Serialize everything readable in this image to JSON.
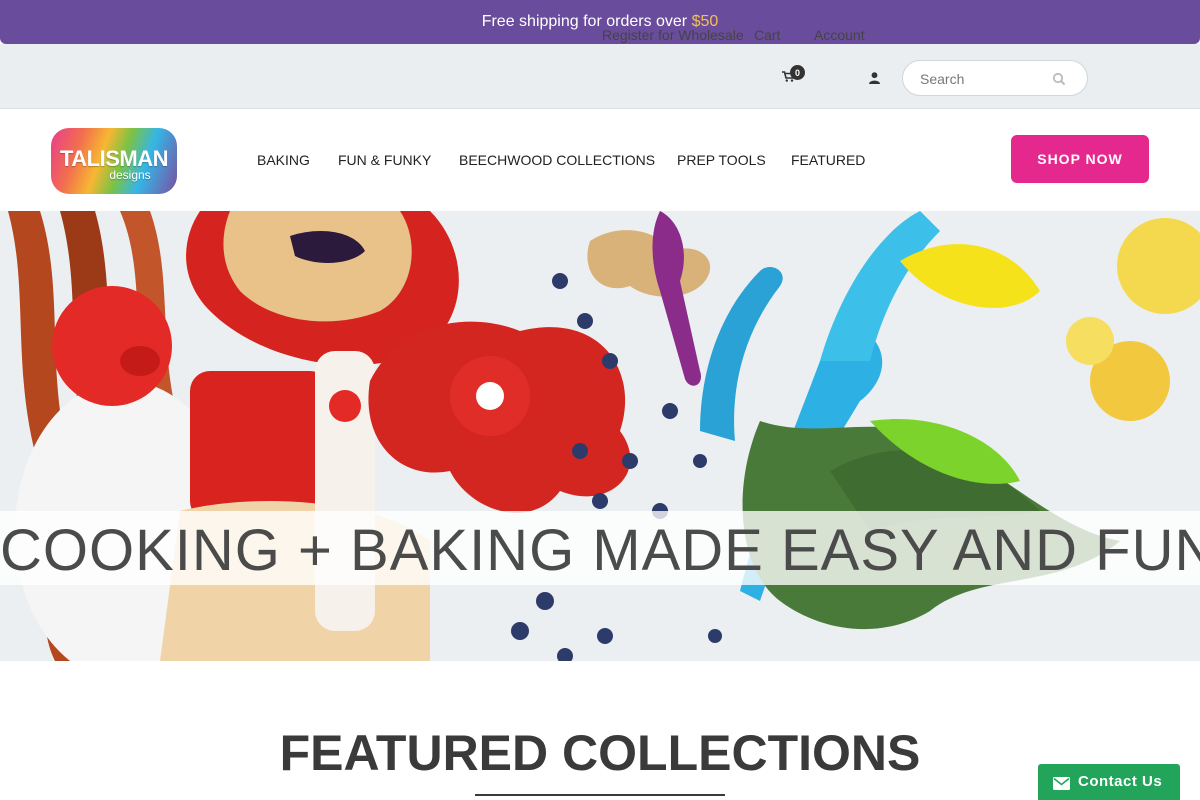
{
  "promo": {
    "text": "Free shipping for orders over",
    "amount": "$50"
  },
  "utility": {
    "wholesale_label": "Register for Wholesale",
    "cart_label": "Cart",
    "cart_count": "0",
    "account_label": "Account",
    "search_placeholder": "Search"
  },
  "nav": {
    "logo_main": "TALISMAN",
    "logo_sub": "designs",
    "items": [
      {
        "label": "BAKING"
      },
      {
        "label": "FUN & FUNKY"
      },
      {
        "label": "BEECHWOOD COLLECTIONS"
      },
      {
        "label": "PREP TOOLS"
      },
      {
        "label": "FEATURED"
      }
    ],
    "cta_label": "SHOP NOW"
  },
  "hero": {
    "headline": "COOKING + BAKING MADE EASY AND FUN"
  },
  "featured": {
    "title": "FEATURED COLLECTIONS"
  },
  "contact": {
    "label": "Contact Us"
  },
  "colors": {
    "promo_bg": "#6a4c9c",
    "promo_amount": "#f2c14e",
    "cta_pink": "#e5288d",
    "contact_green": "#22a45a",
    "utility_bg": "#eaeef0"
  }
}
